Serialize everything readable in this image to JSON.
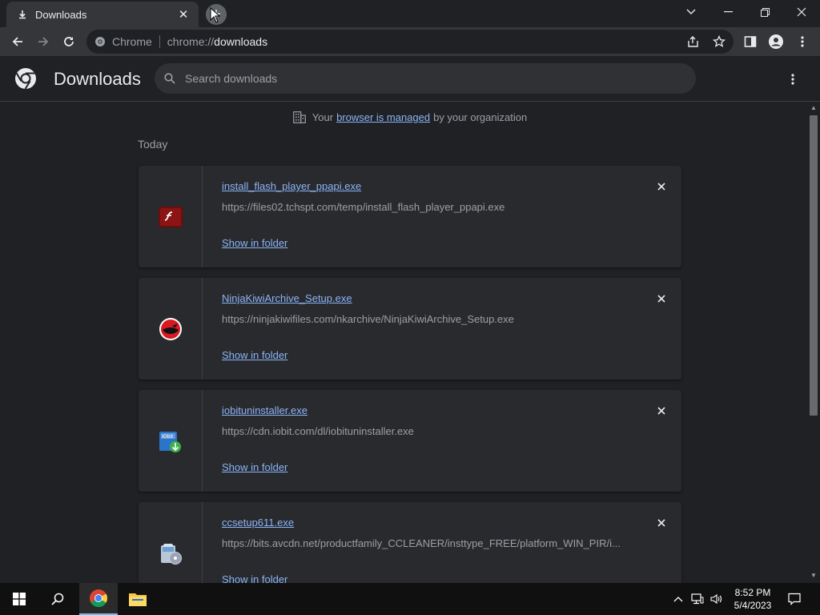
{
  "tab": {
    "title": "Downloads",
    "close_icon": "close-icon",
    "favicon": "download-icon"
  },
  "toolbar": {
    "omnibox_label": "Chrome",
    "url_scheme": "chrome://",
    "url_path": "downloads"
  },
  "header": {
    "title": "Downloads",
    "search_placeholder": "Search downloads"
  },
  "managed": {
    "prefix": "Your",
    "link": "browser is managed",
    "suffix": "by your organization"
  },
  "section": {
    "today": "Today"
  },
  "downloads": [
    {
      "name": "install_flash_player_ppapi.exe",
      "url": "https://files02.tchspt.com/temp/install_flash_player_ppapi.exe",
      "action": "Show in folder"
    },
    {
      "name": "NinjaKiwiArchive_Setup.exe",
      "url": "https://ninjakiwifiles.com/nkarchive/NinjaKiwiArchive_Setup.exe",
      "action": "Show in folder"
    },
    {
      "name": "iobituninstaller.exe",
      "url": "https://cdn.iobit.com/dl/iobituninstaller.exe",
      "action": "Show in folder"
    },
    {
      "name": "ccsetup611.exe",
      "url": "https://bits.avcdn.net/productfamily_CCLEANER/insttype_FREE/platform_WIN_PIR/i...",
      "action": "Show in folder"
    }
  ],
  "taskbar": {
    "time": "8:52 PM",
    "date": "5/4/2023"
  },
  "colors": {
    "accent": "#8ab4f8",
    "background": "#202124",
    "card": "#292a2d"
  }
}
